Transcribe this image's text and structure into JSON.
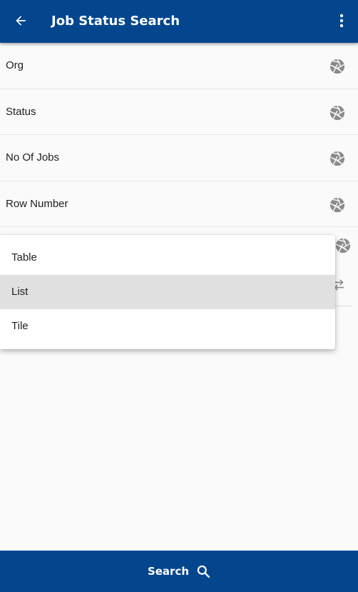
{
  "header": {
    "title": "Job Status Search",
    "back_icon": "arrow-left-icon",
    "more_icon": "more-vert-icon",
    "color": "#04468e"
  },
  "fields": [
    {
      "label": "Org",
      "icon": "aperture-icon"
    },
    {
      "label": "Status",
      "icon": "aperture-icon"
    },
    {
      "label": "No Of Jobs",
      "icon": "aperture-icon"
    },
    {
      "label": "Row Number",
      "icon": "aperture-icon"
    }
  ],
  "view_menu": {
    "options": [
      "Table",
      "List",
      "Tile"
    ],
    "selected": "List"
  },
  "footer": {
    "search_label": "Search",
    "icon": "search-icon"
  }
}
